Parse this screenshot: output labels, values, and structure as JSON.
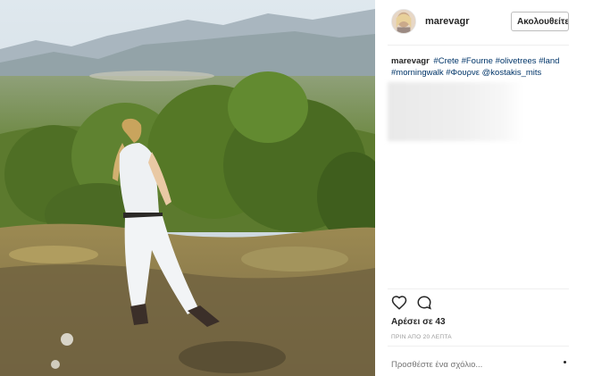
{
  "post": {
    "username": "marevagr",
    "follow_label": "Ακολουθείτε",
    "caption": {
      "author": "marevagr",
      "parts": [
        {
          "text": "#Crete",
          "type": "tag"
        },
        {
          "text": " ",
          "type": "text"
        },
        {
          "text": "#Fourne",
          "type": "tag"
        },
        {
          "text": " ",
          "type": "text"
        },
        {
          "text": "#olivetrees",
          "type": "tag"
        },
        {
          "text": " ",
          "type": "text"
        },
        {
          "text": "#land",
          "type": "tag"
        },
        {
          "text": " ",
          "type": "text"
        },
        {
          "text": "#morningwalk",
          "type": "tag"
        },
        {
          "text": " ",
          "type": "text"
        },
        {
          "text": "#Φουρνε",
          "type": "tag"
        },
        {
          "text": " ",
          "type": "text"
        },
        {
          "text": "@kostakis_mits",
          "type": "tag"
        }
      ]
    },
    "likes": "Αρέσει σε 43",
    "timestamp": "ΠΡΙΝ ΑΠΟ 20 ΛΕΠΤΑ",
    "comment_placeholder": "Προσθέστε ένα σχόλιο..."
  },
  "icons": {
    "like": "heart-icon",
    "comment": "comment-bubble-icon",
    "more": "more-options-icon"
  },
  "colors": {
    "hashtag": "#003569",
    "muted": "#999999",
    "text": "#262626"
  }
}
